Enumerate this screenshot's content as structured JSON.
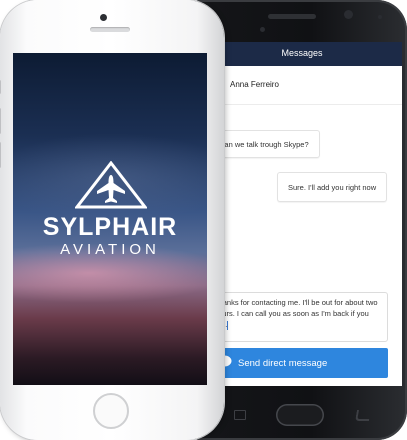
{
  "android": {
    "header": {
      "title": "Messages"
    },
    "contact": {
      "name": "Anna Ferreiro"
    },
    "messages": [
      {
        "text": "Can we talk trough Skype?"
      },
      {
        "text": "Sure. I'll add you right now"
      }
    ],
    "compose": {
      "value": "Thanks for contacting me. I'll be out for about two hours. I can call you as soon as I'm back if you like."
    },
    "send_button": {
      "label": "Send direct message"
    }
  },
  "iphone": {
    "brand_line1": "SYLPHAIR",
    "brand_line2": "AVIATION"
  },
  "colors": {
    "header_bg": "#1c2a47",
    "send_button_bg": "#2e86de"
  }
}
